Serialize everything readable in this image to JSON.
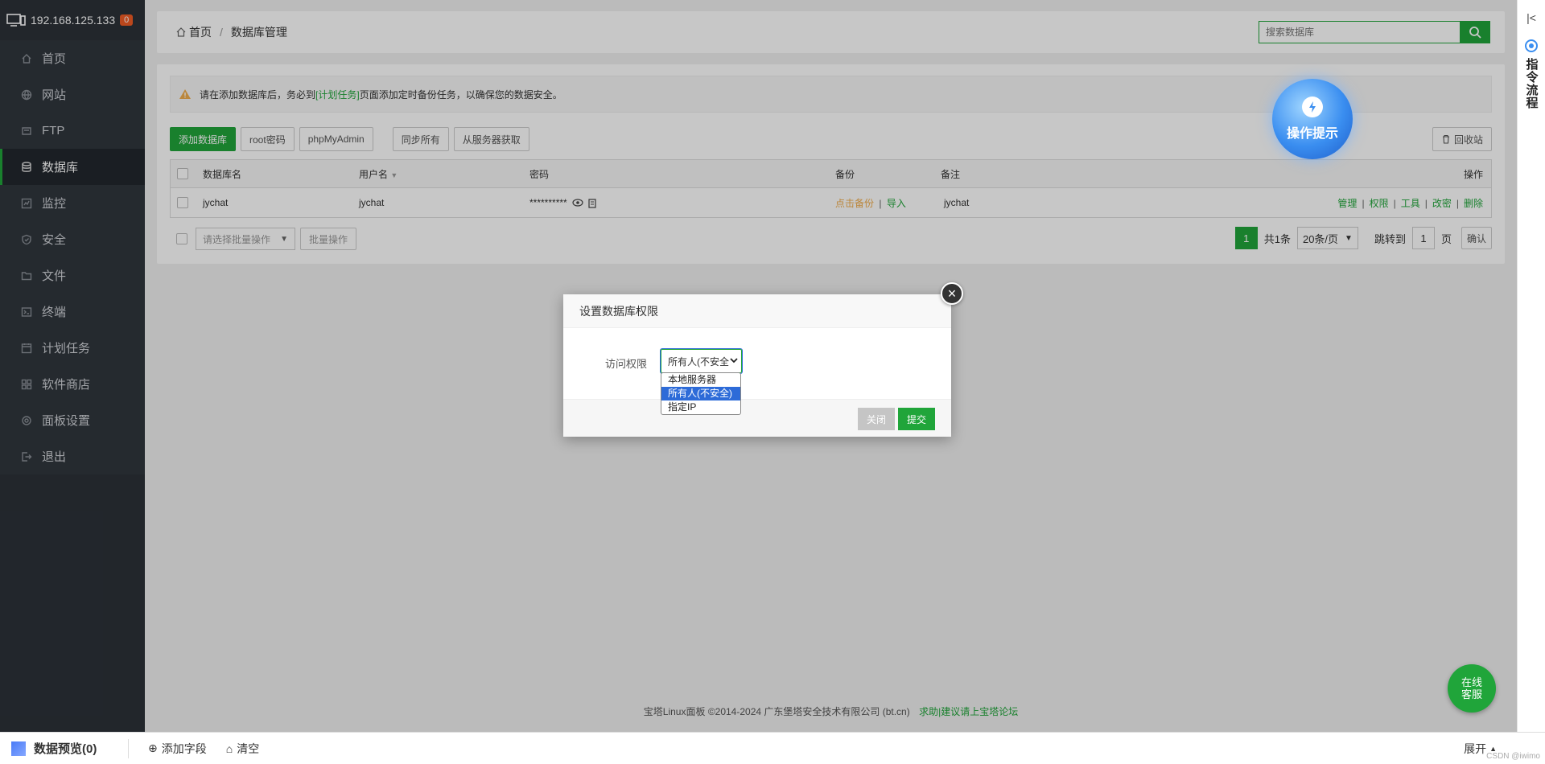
{
  "server": {
    "ip": "192.168.125.133",
    "badge": "0"
  },
  "sidebar": {
    "items": [
      {
        "label": "首页",
        "icon": "home-icon"
      },
      {
        "label": "网站",
        "icon": "globe-icon"
      },
      {
        "label": "FTP",
        "icon": "ftp-icon"
      },
      {
        "label": "数据库",
        "icon": "database-icon",
        "active": true
      },
      {
        "label": "监控",
        "icon": "monitor-icon"
      },
      {
        "label": "安全",
        "icon": "shield-icon"
      },
      {
        "label": "文件",
        "icon": "folder-icon"
      },
      {
        "label": "终端",
        "icon": "terminal-icon"
      },
      {
        "label": "计划任务",
        "icon": "clock-icon"
      },
      {
        "label": "软件商店",
        "icon": "grid-icon"
      },
      {
        "label": "面板设置",
        "icon": "gear-icon"
      },
      {
        "label": "退出",
        "icon": "logout-icon"
      }
    ]
  },
  "breadcrumb": {
    "home": "首页",
    "sep": "/",
    "current": "数据库管理"
  },
  "search": {
    "placeholder": "搜索数据库"
  },
  "notice": {
    "pre": "请在添加数据库后，务必到",
    "link": "[计划任务]",
    "post": "页面添加定时备份任务，以确保您的数据安全。"
  },
  "toolbar": {
    "add_db": "添加数据库",
    "root_pwd": "root密码",
    "phpmyadmin": "phpMyAdmin",
    "sync_all": "同步所有",
    "fetch_server": "从服务器获取",
    "recycle": "回收站"
  },
  "table": {
    "headers": {
      "name": "数据库名",
      "user": "用户名",
      "password": "密码",
      "backup": "备份",
      "note": "备注",
      "ops": "操作"
    },
    "rows": [
      {
        "name": "jychat",
        "user": "jychat",
        "password": "**********",
        "backup_link": "点击备份",
        "import_link": "导入",
        "note": "jychat",
        "ops": [
          "管理",
          "权限",
          "工具",
          "改密",
          "删除"
        ]
      }
    ]
  },
  "batch": {
    "placeholder": "请选择批量操作",
    "button": "批量操作"
  },
  "pager": {
    "current": "1",
    "total": "共1条",
    "per_page": "20条/页",
    "jump_label": "跳转到",
    "jump_value": "1",
    "page_unit": "页",
    "confirm": "确认"
  },
  "footer": {
    "copyright": "宝塔Linux面板 ©2014-2024 广东堡塔安全技术有限公司 (bt.cn)",
    "link": "求助|建议请上宝塔论坛"
  },
  "bubble": {
    "label": "操作提示"
  },
  "chat": {
    "line1": "在线",
    "line2": "客服"
  },
  "rightbar": {
    "label": "指令流程"
  },
  "bottombar": {
    "preview": "数据预览(0)",
    "add_field": "添加字段",
    "clear": "清空",
    "expand": "展开",
    "watermark": "CSDN @iwimo"
  },
  "modal": {
    "title": "设置数据库权限",
    "label": "访问权限",
    "selected": "所有人(不安全",
    "options": [
      "本地服务器",
      "所有人(不安全)",
      "指定IP"
    ],
    "selected_index": 1,
    "close": "关闭",
    "submit": "提交"
  },
  "colors": {
    "accent": "#20a53a",
    "sidebar": "#2c3138",
    "warn": "#f0ad4e",
    "select_highlight": "#2d6bd8"
  }
}
